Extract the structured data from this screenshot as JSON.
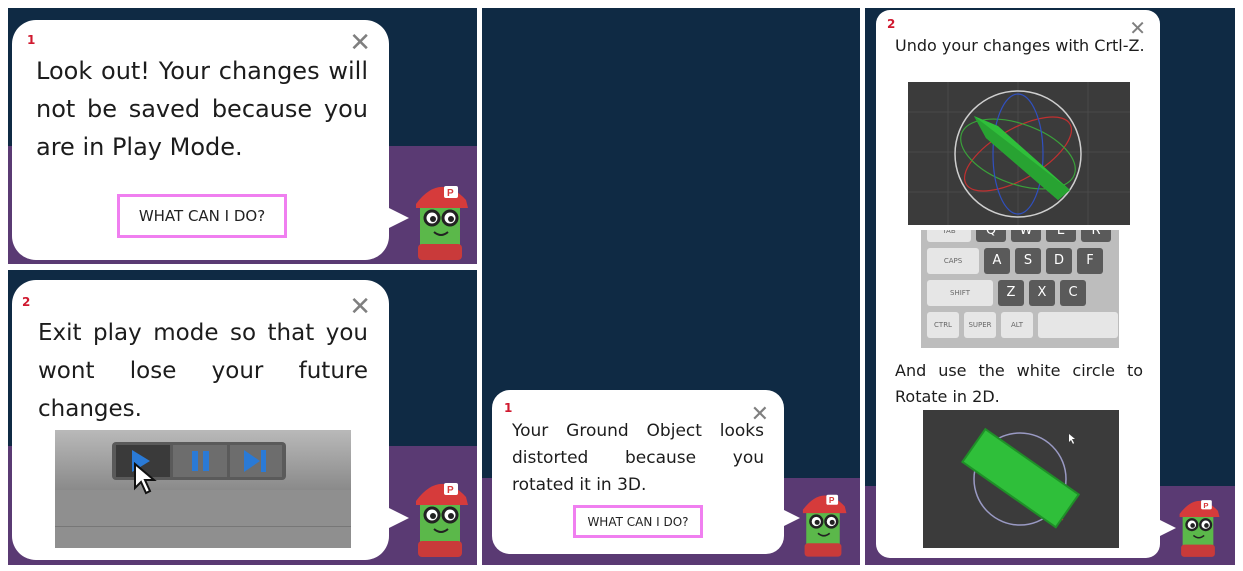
{
  "panels": {
    "p1": {
      "num": "1",
      "text": "Look out! Your changes will not be saved because you are in Play Mode.",
      "button": "WHAT CAN I DO?",
      "close": "✕"
    },
    "p2": {
      "num": "2",
      "text": "Exit play mode so that you wont lose your future changes.",
      "close": "✕"
    },
    "p3": {
      "num": "1",
      "text": "Your Ground Object looks distorted because you rotated it in 3D.",
      "button": "WHAT CAN I DO?",
      "close": "✕"
    },
    "p4": {
      "num": "2",
      "text1": "Undo your changes with Crtl-Z.",
      "text2": "And use the white circle to Rotate in 2D.",
      "close": "✕",
      "keyboard_keys": [
        "TAB",
        "Q",
        "W",
        "E",
        "R",
        "CAPS",
        "A",
        "S",
        "D",
        "F",
        "SHIFT",
        "Z",
        "X",
        "C",
        "CTRL",
        "SUPER",
        "ALT"
      ]
    }
  },
  "colors": {
    "background_dark": "#0f2a44",
    "band_purple": "#5a3a73",
    "accent_pink": "#f07ff0",
    "number_red": "#d0192f",
    "mascot_green": "#5bb84a",
    "cap_red": "#d63b3b",
    "object_green": "#2fbf3a"
  },
  "icons": [
    "close-icon",
    "play-icon",
    "pause-icon",
    "step-icon",
    "cursor-icon",
    "mascot"
  ]
}
